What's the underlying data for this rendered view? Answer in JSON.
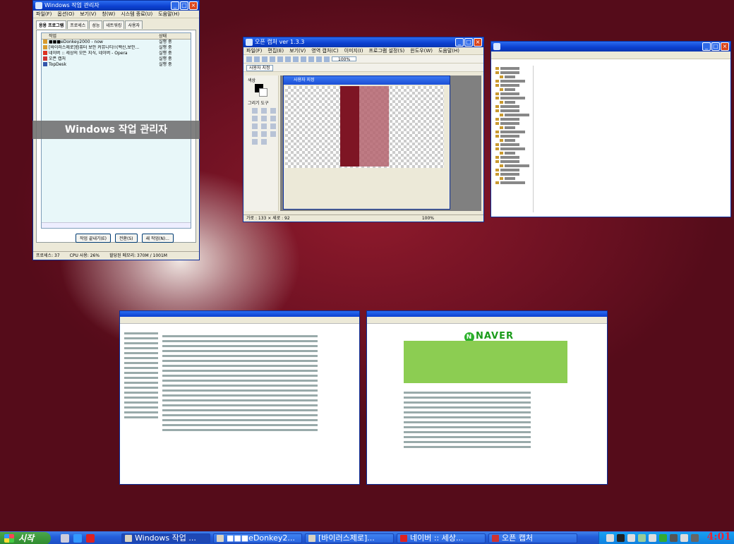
{
  "task_manager": {
    "title": "Windows 작업 관리자",
    "menu": [
      "파일(F)",
      "옵션(O)",
      "보기(V)",
      "창(W)",
      "시스템 종료(U)",
      "도움말(H)"
    ],
    "tabs": [
      "응용 프로그램",
      "프로세스",
      "성능",
      "네트워킹",
      "사용자"
    ],
    "columns": [
      "작업",
      "상태"
    ],
    "rows": [
      {
        "task": "■■■eDonkey2000 - now",
        "status": "실행 중"
      },
      {
        "task": "[바이러스제로]컴퓨터 보안 커뮤니티!!(백신,보안...",
        "status": "실행 중"
      },
      {
        "task": "네이버 :: 세상의 모든 지식, 네이버 - Opera",
        "status": "실행 중"
      },
      {
        "task": "오픈 캡처",
        "status": "실행 중"
      },
      {
        "task": "TopDesk",
        "status": "실행 중"
      }
    ],
    "buttons": [
      "작업 끝내기(E)",
      "전환(S)",
      "새 작업(N)..."
    ],
    "status": {
      "processes": "프로세스: 37",
      "cpu": "CPU 사용: 26%",
      "memory": "할당된 메모리: 370M / 1001M"
    }
  },
  "tooltip": "Windows 작업 관리자",
  "paint": {
    "title": "오픈 캡처 ver 1.3.3",
    "menu": [
      "파일(F)",
      "편집(E)",
      "보기(V)",
      "영역 캡처(C)",
      "이미지(I)",
      "프로그램 설정(S)",
      "윈도우(W)",
      "도움말(H)"
    ],
    "zoom": "100%",
    "selection_mode": "사용자 지정",
    "colors_label": "색상",
    "tools_label": "그리기 도구",
    "image_title": "사용자 지정",
    "status_left": "가로 : 133 × 세로 : 92",
    "status_zoom": "100%"
  },
  "taskbar": {
    "start": "시작",
    "tasks": [
      "Windows 작업 ...",
      "■■■eDonkey2...",
      "[바이러스제로]...",
      "네이버 :: 세상...",
      "오픈 캡처"
    ],
    "clock": "4:01"
  }
}
